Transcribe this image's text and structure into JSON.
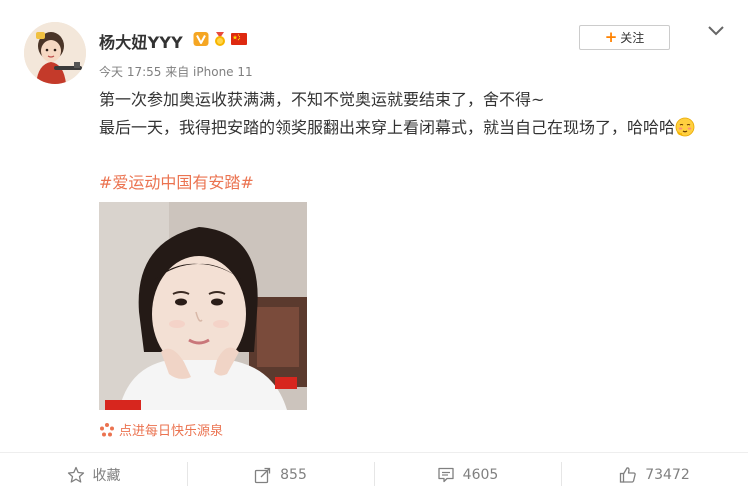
{
  "author": {
    "name": "杨大妞YYY",
    "badges": [
      "verified-v-icon",
      "gold-medal-icon",
      "china-flag-icon"
    ]
  },
  "post_meta": {
    "time": "今天 17:55",
    "via": "来自 iPhone 11"
  },
  "follow_button": {
    "label": "关注"
  },
  "content": {
    "line1": "第一次参加奥运收获满满，不知不觉奥运就要结束了，舍不得~",
    "line2": "最后一天，我得把安踏的领奖服翻出来穿上看闭幕式，就当自己在现场了，哈哈哈",
    "hashtag": "#爱运动中国有安踏#"
  },
  "source_link": {
    "label": "点进每日快乐源泉"
  },
  "actions": {
    "favorite": {
      "label": "收藏"
    },
    "repost": {
      "count": "855"
    },
    "comment": {
      "count": "4605"
    },
    "like": {
      "count": "73472"
    }
  },
  "colors": {
    "accent": "#eb7350",
    "follow_plus": "#ff8200",
    "meta_text": "#808080"
  }
}
